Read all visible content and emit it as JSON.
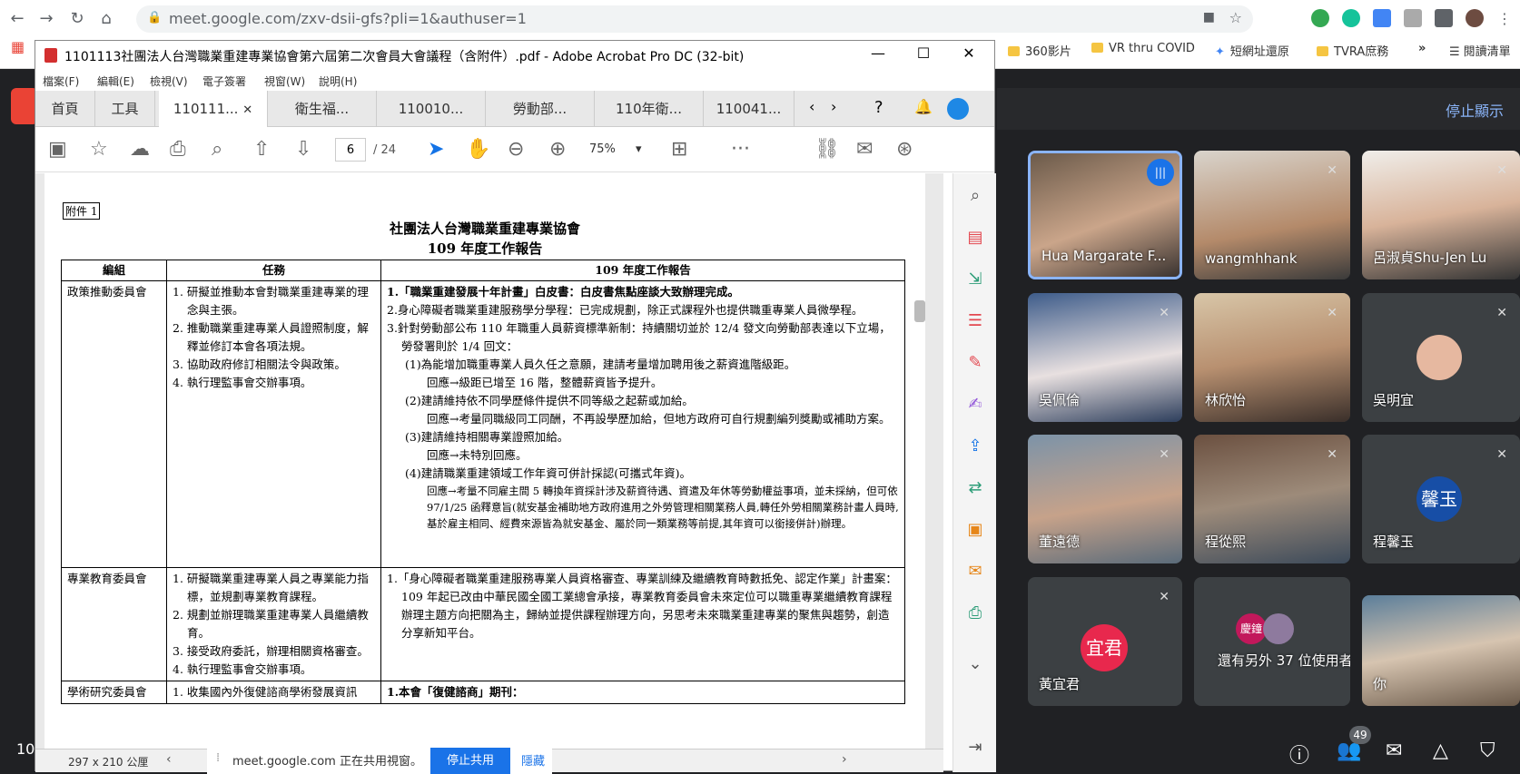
{
  "browser": {
    "url": "meet.google.com/zxv-dsii-gfs?pli=1&authuser=1",
    "bookmarks": [
      "360影片",
      "VR thru COVID",
      "短網址還原",
      "TVRA庶務",
      "»",
      "閱讀清單"
    ]
  },
  "meet": {
    "stop_presenting": "停止顯示",
    "participants": [
      {
        "name": "Hua Margarate F..."
      },
      {
        "name": "wangmhhank"
      },
      {
        "name": "呂淑貞Shu-Jen Lu"
      },
      {
        "name": "吳佩倫"
      },
      {
        "name": "林欣怡"
      },
      {
        "name": "吳明宜"
      },
      {
        "name": "董遠德"
      },
      {
        "name": "程從熙"
      },
      {
        "name": "程馨玉",
        "avatar_text": "馨玉"
      },
      {
        "name": "黃宜君",
        "avatar_text": "宜君"
      },
      {
        "name": "還有另外 37 位使用者",
        "avatar_text": "慶鐘"
      },
      {
        "name": "你"
      }
    ],
    "people_count": "49",
    "time_partial": "10"
  },
  "acrobat": {
    "title": "1101113社團法人台灣職業重建專業協會第六屆第二次會員大會議程（含附件）.pdf - Adobe Acrobat Pro DC (32-bit)",
    "menu": [
      "檔案(F)",
      "編輯(E)",
      "檢視(V)",
      "電子簽署",
      "視窗(W)",
      "說明(H)"
    ],
    "home": "首頁",
    "tools": "工具",
    "tabs": [
      "110111...",
      "衛生福...",
      "110010...",
      "勞動部...",
      "110年衛...",
      "110041..."
    ],
    "page_num": "6",
    "page_total": "/ 24",
    "zoom": "75%",
    "page_size": "297 x 210 公厘"
  },
  "doc": {
    "attachment": "附件 1",
    "title1": "社團法人台灣職業重建專業協會",
    "title2": "109 年度工作報告",
    "headers": [
      "編組",
      "任務",
      "109 年度工作報告"
    ],
    "row1_group": "政策推動委員會",
    "row1_tasks": [
      "1. 研擬並推動本會對職業重建專業的理念與主張。",
      "2. 推動職業重建專業人員證照制度，解釋並修訂本會各項法規。",
      "3. 協助政府修訂相關法令與政策。",
      "4. 執行理監事會交辦事項。"
    ],
    "row1_report": [
      "1.「職業重建發展十年計畫」白皮書：白皮書焦點座談大致辦理完成。",
      "2.身心障礙者職業重建服務學分學程：已完成規劃，除正式課程外也提供職重專業人員微學程。",
      "3.針對勞動部公布 110 年職重人員薪資標準新制：持續關切並於 12/4 發文向勞動部表達以下立場，勞發署則於 1/4 回文：",
      "(1)為能增加職重專業人員久任之意願，建請考量增加聘用後之薪資進階級距。",
      "回應→級距已增至 16 階，整體薪資皆予提升。",
      "(2)建請維持依不同學歷條件提供不同等級之起薪或加給。",
      "回應→考量同職級同工同酬，不再設學歷加給，但地方政府可自行規劃編列獎勵或補助方案。",
      "(3)建請維持相關專業證照加給。",
      "回應→未特別回應。",
      "(4)建請職業重建領域工作年資可併計採認(可攜式年資)。",
      "回應→考量不同雇主間 5 轉換年資採計涉及薪資待遇、資遣及年休等勞動權益事項，並未採納，但可依 97/1/25 函釋意旨(就安基金補助地方政府進用之外勞管理相關業務人員,轉任外勞相關業務計畫人員時,基於雇主相同、經費來源皆為就安基金、屬於同一類業務等前提,其年資可以銜接併計)辦理。"
    ],
    "row2_group": "專業教育委員會",
    "row2_tasks": [
      "1. 研擬職業重建專業人員之專業能力指標，並規劃專業教育課程。",
      "2. 規劃並辦理職業重建專業人員繼續教育。",
      "3. 接受政府委託，辦理相關資格審查。",
      "4. 執行理監事會交辦事項。"
    ],
    "row2_report": "1.「身心障礙者職業重建服務專業人員資格審查、專業訓練及繼續教育時數抵免、認定作業」計畫案：109 年起已改由中華民國全國工業總會承接，專業教育委員會未來定位可以職重專業繼續教育課程辦理主題方向把關為主，歸納並提供課程辦理方向，另思考未來職業重建專業的聚焦與趨勢，創造分享新知平台。",
    "row3_group": "學術研究委員會",
    "row3_task": "1. 收集國內外復健諮商學術發展資訊",
    "row3_report": "1.本會「復健諮商」期刊："
  },
  "sharebar": {
    "text": "meet.google.com 正在共用視窗。",
    "stop": "停止共用",
    "hide": "隱藏"
  }
}
